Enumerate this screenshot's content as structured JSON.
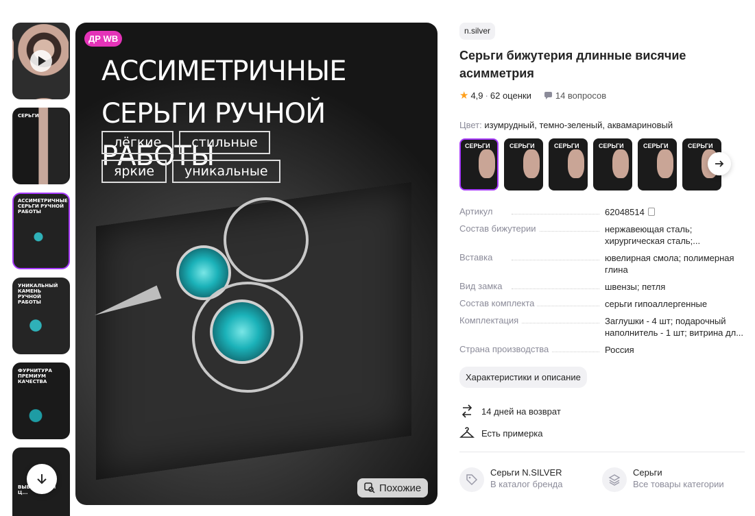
{
  "gallery": {
    "video_label": "",
    "thumbs": [
      {
        "caption": ""
      },
      {
        "caption": "СЕРЬГИ"
      },
      {
        "caption": "АССИМЕТРИЧНЫЕ СЕРЬГИ РУЧНОЙ РАБОТЫ"
      },
      {
        "caption": "УНИКАЛЬНЫЙ КАМЕНЬ РУЧНОЙ РАБОТЫ"
      },
      {
        "caption": "ФУРНИТУРА ПРЕМИУМ КАЧЕСТВА"
      },
      {
        "caption": "ВЫБЕ... СВОЙ Ц..."
      }
    ],
    "scroll_down_icon": "arrow-down-icon"
  },
  "main_image": {
    "badge": "ДР WB",
    "headline_line1": "АССИМЕТРИЧНЫЕ",
    "headline_line2": "СЕРЬГИ РУЧНОЙ РАБОТЫ",
    "tags": [
      "лёгкие",
      "стильные",
      "яркие",
      "уникальные"
    ],
    "similar_label": "Похожие"
  },
  "product": {
    "brand": "n.silver",
    "title": "Серьги бижутерия длинные висячие асимметрия",
    "rating": "4,9",
    "reviews": "62 оценки",
    "questions": "14 вопросов",
    "color_label": "Цвет:",
    "color_value": "изумрудный, темно-зеленый, аквамариновый",
    "swatches": [
      "СЕРЬГИ",
      "СЕРЬГИ",
      "СЕРЬГИ",
      "СЕРЬГИ",
      "СЕРЬГИ",
      "СЕРЬГИ"
    ],
    "specs": [
      {
        "name": "Артикул",
        "value": "62048514"
      },
      {
        "name": "Состав бижутерии",
        "value": "нержавеющая сталь; хирургическая сталь;..."
      },
      {
        "name": "Вставка",
        "value": "ювелирная смола; полимерная глина"
      },
      {
        "name": "Вид замка",
        "value": "швензы; петля"
      },
      {
        "name": "Состав комплекта",
        "value": "серьги гипоаллергенные"
      },
      {
        "name": "Комплектация",
        "value": "Заглушки - 4 шт; подарочный наполнитель - 1 шт; витрина дл..."
      },
      {
        "name": "Страна производства",
        "value": "Россия"
      }
    ],
    "description_button": "Характеристики и описание",
    "return_policy": "14 дней на возврат",
    "fitting": "Есть примерка",
    "brand_link_title": "Серьги N.SILVER",
    "brand_link_sub": "В каталог бренда",
    "category_link_title": "Серьги",
    "category_link_sub": "Все товары категории"
  },
  "colors": {
    "accent": "#a73afd",
    "badge": "#e433b8",
    "star": "#ff9f1a"
  }
}
